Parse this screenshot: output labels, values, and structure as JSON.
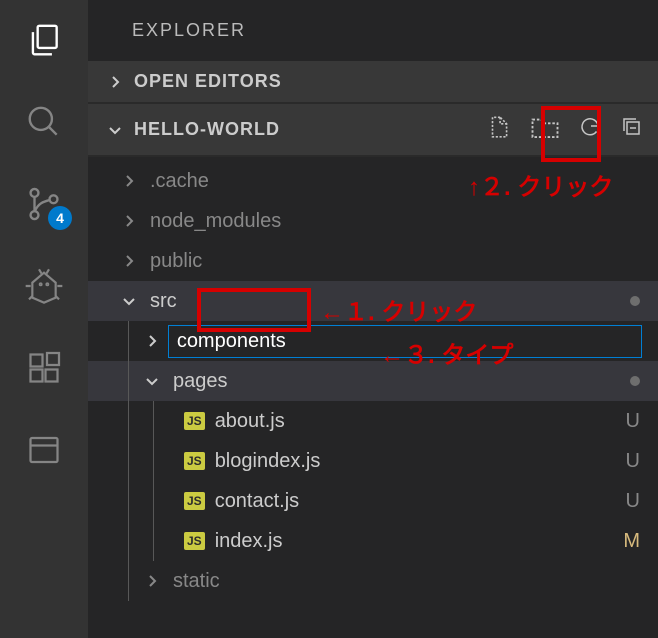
{
  "sidebar": {
    "title": "EXPLORER",
    "openEditors": "OPEN EDITORS",
    "projectName": "HELLO-WORLD"
  },
  "scmBadge": "4",
  "folders": {
    "cache": ".cache",
    "nodeModules": "node_modules",
    "public": "public",
    "src": "src",
    "pages": "pages",
    "static": "static"
  },
  "newFolderInput": "components",
  "files": {
    "about": {
      "name": "about.js",
      "status": "U"
    },
    "blogindex": {
      "name": "blogindex.js",
      "status": "U"
    },
    "contact": {
      "name": "contact.js",
      "status": "U"
    },
    "index": {
      "name": "index.js",
      "status": "M"
    }
  },
  "jsLabel": "JS",
  "annotations": {
    "step1": "←１. クリック",
    "step2": "↑２. クリック",
    "step3": "←３. タイプ"
  }
}
